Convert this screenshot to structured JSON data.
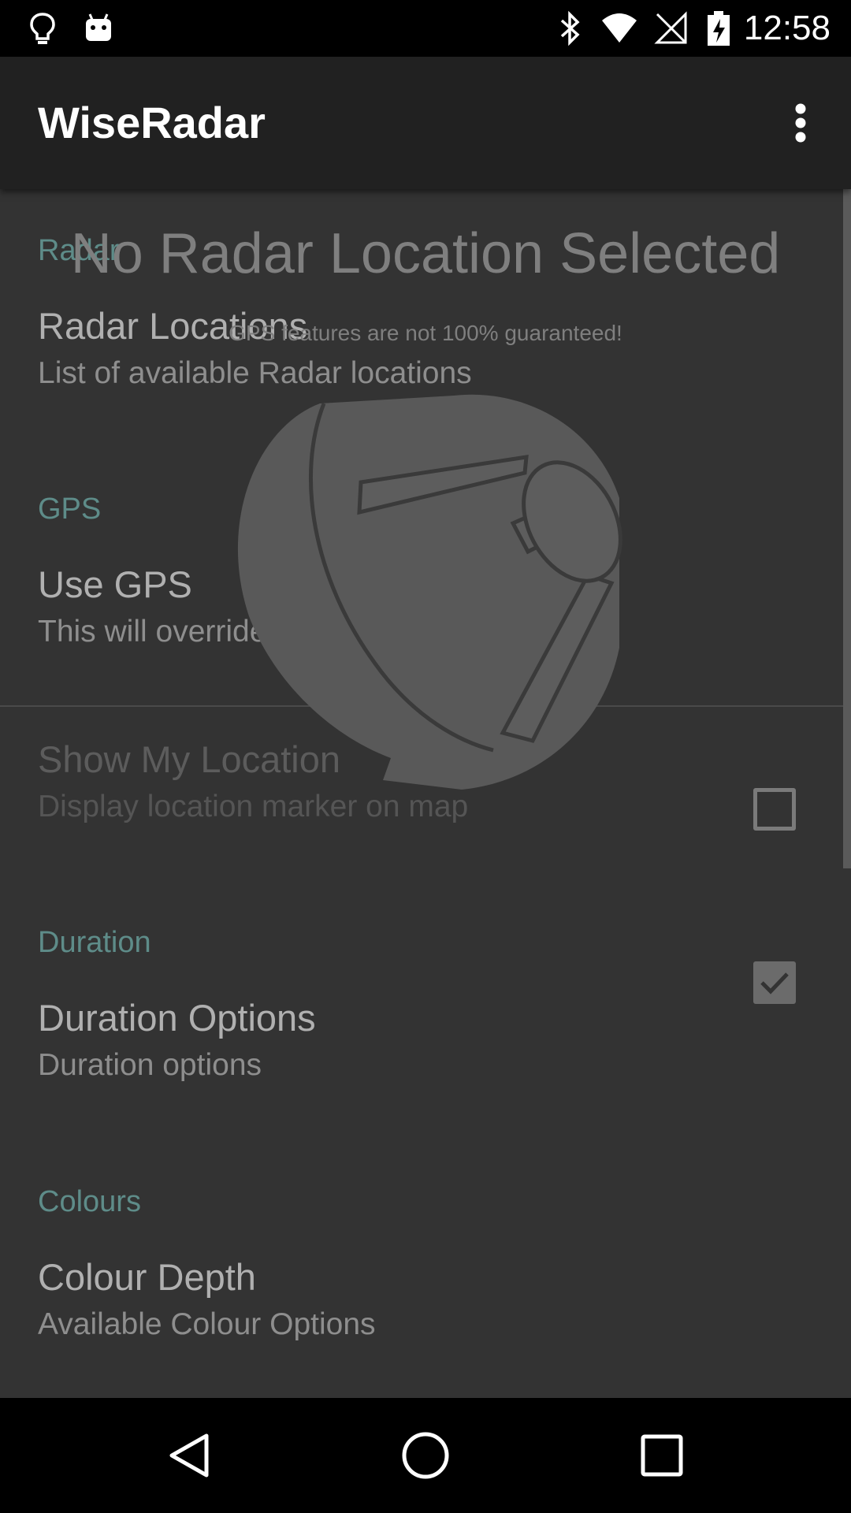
{
  "status_bar": {
    "time": "12:58",
    "icons": [
      "lightbulb-icon",
      "android-icon",
      "bluetooth-icon",
      "wifi-icon",
      "no-signal-icon",
      "battery-charging-icon"
    ]
  },
  "app_bar": {
    "title": "WiseRadar",
    "overflow_icon": "more-vert-icon"
  },
  "overlay": {
    "title": "No Radar Location Selected",
    "subtitle": "GPS features are not 100% guaranteed!",
    "image_icon": "radar-dish-icon"
  },
  "preferences": {
    "radar": {
      "category": "Radar",
      "locations_title": "Radar Locations",
      "locations_summary": "List of available Radar locations"
    },
    "gps": {
      "category": "GPS",
      "use_gps_title": "Use GPS",
      "use_gps_summary": "This will override Radar Selection",
      "use_gps_checked": false,
      "show_location_title": "Show My Location",
      "show_location_summary": "Display location marker on map",
      "show_location_checked": true
    },
    "duration": {
      "category": "Duration",
      "options_title": "Duration Options",
      "options_summary": "Duration options"
    },
    "colours": {
      "category": "Colours",
      "depth_title": "Colour Depth",
      "depth_summary": "Available Colour Options"
    }
  },
  "nav_bar": {
    "icons": [
      "back-icon",
      "home-icon",
      "recents-icon"
    ]
  },
  "colors": {
    "category_accent": "#5e8c89",
    "background": "#333333",
    "app_bar": "#212121"
  }
}
